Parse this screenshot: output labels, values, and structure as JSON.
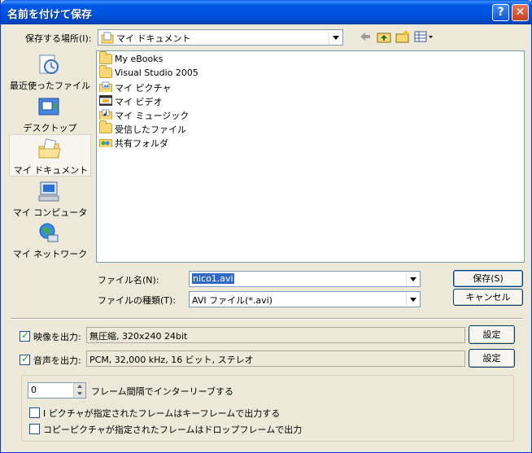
{
  "window": {
    "title": "名前を付けて保存",
    "help_glyph": "?",
    "close_glyph": "✕"
  },
  "save_in": {
    "label": "保存する場所(I):",
    "value": "マイ ドキュメント"
  },
  "toolbar_icons": [
    "back-arrow-icon",
    "up-folder-icon",
    "new-folder-icon",
    "view-menu-icon"
  ],
  "places": [
    {
      "label": "最近使ったファイル",
      "icon": "recent-documents-icon"
    },
    {
      "label": "デスクトップ",
      "icon": "desktop-icon"
    },
    {
      "label": "マイ ドキュメント",
      "icon": "my-documents-icon",
      "active": true
    },
    {
      "label": "マイ コンピュータ",
      "icon": "my-computer-icon"
    },
    {
      "label": "マイ ネットワーク",
      "icon": "my-network-icon"
    }
  ],
  "files": [
    {
      "name": "My eBooks",
      "icon": "folder-icon"
    },
    {
      "name": "Visual Studio 2005",
      "icon": "folder-icon"
    },
    {
      "name": "マイ ピクチャ",
      "icon": "pictures-folder-icon"
    },
    {
      "name": "マイ ビデオ",
      "icon": "videos-folder-icon"
    },
    {
      "name": "マイ ミュージック",
      "icon": "music-folder-icon"
    },
    {
      "name": "受信したファイル",
      "icon": "folder-icon"
    },
    {
      "name": "共有フォルダ",
      "icon": "shared-folder-icon"
    }
  ],
  "filename": {
    "label": "ファイル名(N):",
    "value": "nico1.avi"
  },
  "filetype": {
    "label": "ファイルの種類(T):",
    "value": "AVI ファイル(*.avi)"
  },
  "buttons": {
    "save": "保存(S)",
    "cancel": "キャンセル",
    "settings": "設定"
  },
  "video": {
    "label": "映像を出力:",
    "checked": true,
    "value": "無圧縮, 320x240 24bit"
  },
  "audio": {
    "label": "音声を出力:",
    "checked": true,
    "value": "PCM, 32,000 kHz, 16 ビット, ステレオ"
  },
  "interleave": {
    "value": "0",
    "label": "フレーム間隔でインターリーブする"
  },
  "options": [
    {
      "label": "I ピクチャが指定されたフレームはキーフレームで出力する",
      "checked": false
    },
    {
      "label": "コピーピクチャが指定されたフレームはドロップフレームで出力",
      "checked": false
    }
  ],
  "colors": {
    "titlebar": "#0054e3",
    "window_bg": "#ece9d8",
    "selection": "#316ac5",
    "border": "#7f9db9"
  }
}
